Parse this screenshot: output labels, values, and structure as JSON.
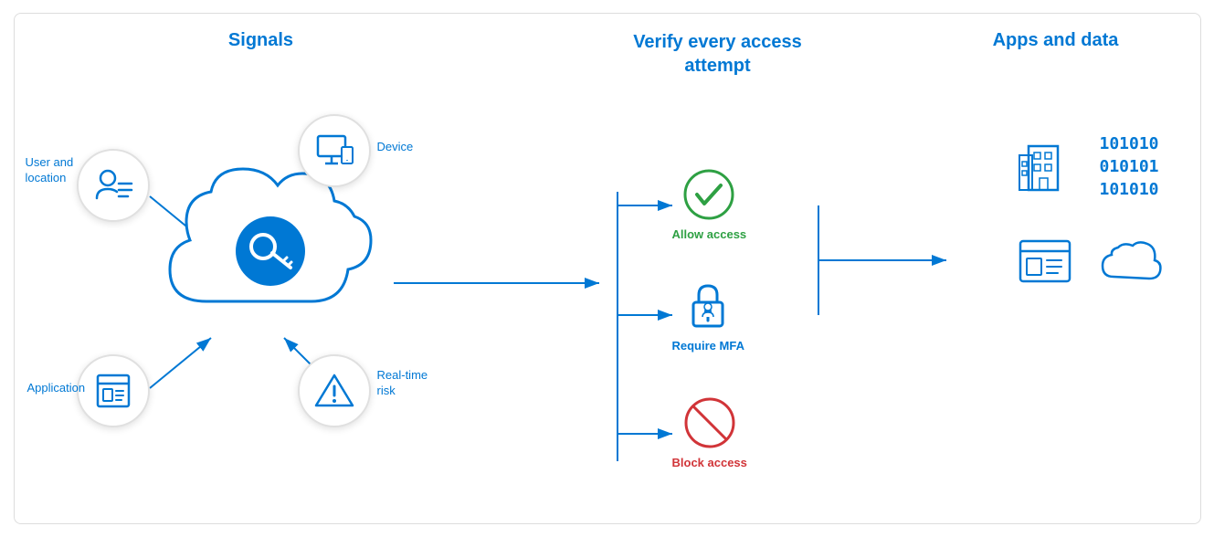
{
  "titles": {
    "signals": "Signals",
    "verify": "Verify every access attempt",
    "apps": "Apps and data"
  },
  "signals": [
    {
      "id": "user-location",
      "label": "User and\nlocation",
      "type": "user"
    },
    {
      "id": "device",
      "label": "Device",
      "type": "device"
    },
    {
      "id": "application",
      "label": "Application",
      "type": "app"
    },
    {
      "id": "realtime-risk",
      "label": "Real-time\nrisk",
      "type": "risk"
    }
  ],
  "access_options": [
    {
      "id": "allow",
      "label": "Allow access",
      "color": "green"
    },
    {
      "id": "mfa",
      "label": "Require MFA",
      "color": "blue"
    },
    {
      "id": "block",
      "label": "Block access",
      "color": "red"
    }
  ],
  "apps": [
    {
      "id": "building",
      "label": "Building"
    },
    {
      "id": "data",
      "label": "Data"
    },
    {
      "id": "app-window",
      "label": "App window"
    },
    {
      "id": "cloud",
      "label": "Cloud"
    }
  ]
}
